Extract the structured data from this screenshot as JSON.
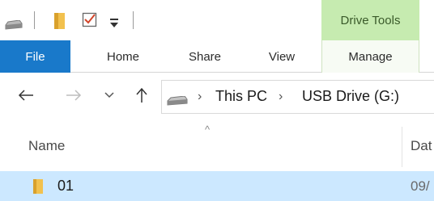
{
  "quick_access": {
    "icons": [
      "drive-icon",
      "new-folder-icon",
      "properties-icon",
      "customize-dropdown-icon"
    ]
  },
  "ribbon": {
    "contextual_group": "Drive Tools",
    "tabs": [
      {
        "label": "File",
        "active": true
      },
      {
        "label": "Home"
      },
      {
        "label": "Share"
      },
      {
        "label": "View"
      },
      {
        "label": "Manage"
      }
    ]
  },
  "address_bar": {
    "breadcrumb": [
      "This PC",
      "USB Drive (G:)"
    ]
  },
  "file_list": {
    "columns": [
      "Name",
      "Dat"
    ],
    "rows": [
      {
        "name": "01",
        "date": "09/"
      }
    ]
  },
  "colors": {
    "file_tab": "#1979ca",
    "contextual_group": "#c6ebb0",
    "selected_row": "#cce8ff"
  }
}
